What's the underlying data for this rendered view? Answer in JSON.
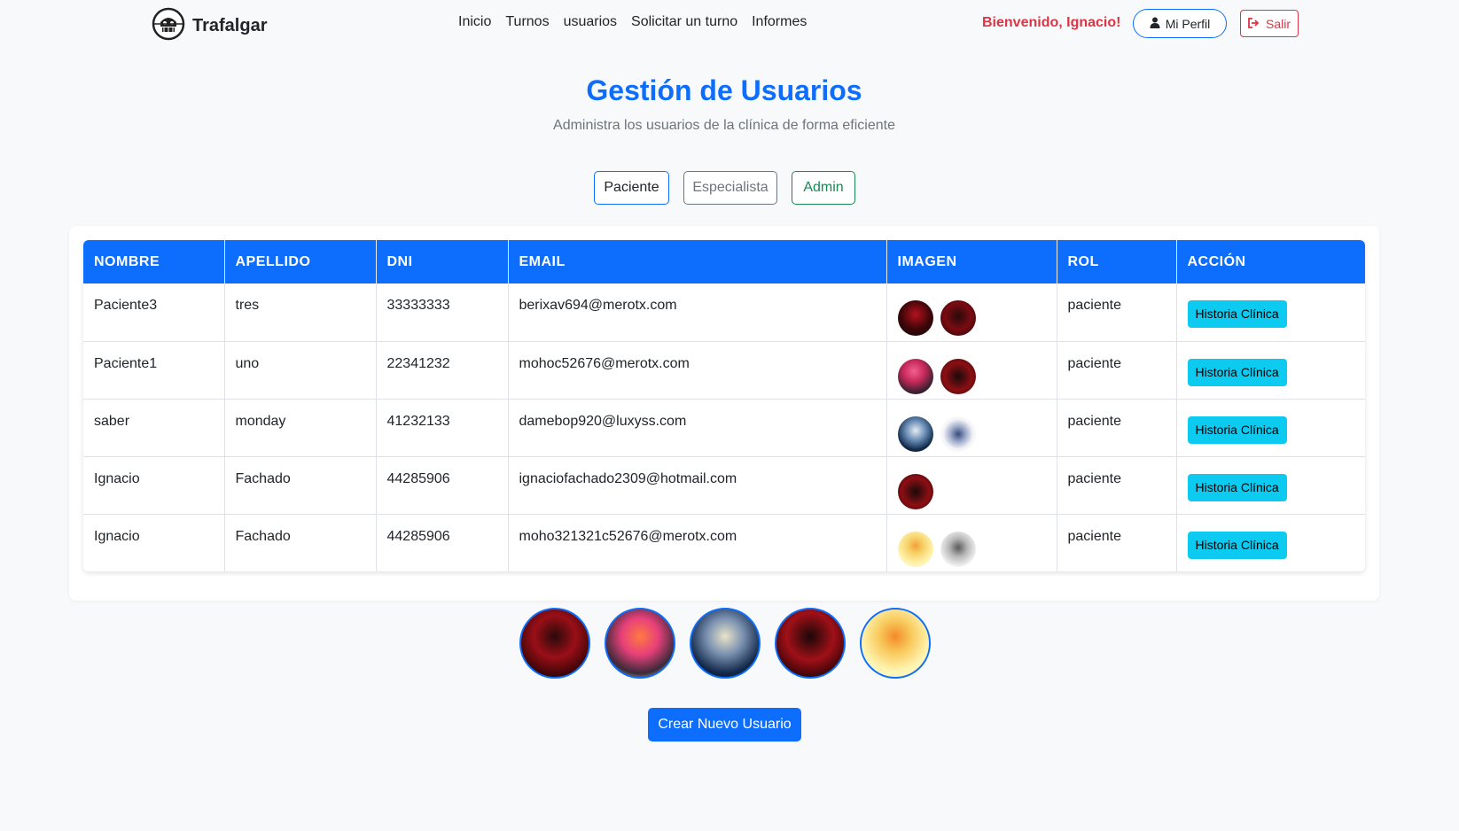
{
  "brand": {
    "name": "Trafalgar",
    "logo_icon": "jolly-roger-icon"
  },
  "nav": {
    "links": [
      "Inicio",
      "Turnos",
      "usuarios",
      "Solicitar un turno",
      "Informes"
    ]
  },
  "user": {
    "welcome": "Bienvenido, Ignacio!",
    "profile_label": "Mi Perfil",
    "logout_label": "Salir"
  },
  "header": {
    "title": "Gestión de Usuarios",
    "subtitle": "Administra los usuarios de la clínica de forma eficiente"
  },
  "filters": {
    "paciente": "Paciente",
    "especialista": "Especialista",
    "admin": "Admin"
  },
  "table": {
    "headers": [
      "NOMBRE",
      "APELLIDO",
      "DNI",
      "EMAIL",
      "IMAGEN",
      "ROL",
      "ACCIÓN"
    ],
    "rows": [
      {
        "nombre": "Paciente3",
        "apellido": "tres",
        "dni": "33333333",
        "email": "berixav694@merotx.com",
        "rol": "paciente",
        "accion": "Historia Clínica"
      },
      {
        "nombre": "Paciente1",
        "apellido": "uno",
        "dni": "22341232",
        "email": "mohoc52676@merotx.com",
        "rol": "paciente",
        "accion": "Historia Clínica"
      },
      {
        "nombre": "saber",
        "apellido": "monday",
        "dni": "41232133",
        "email": "damebop920@luxyss.com",
        "rol": "paciente",
        "accion": "Historia Clínica"
      },
      {
        "nombre": "Ignacio",
        "apellido": "Fachado",
        "dni": "44285906",
        "email": "ignaciofachado2309@hotmail.com",
        "rol": "paciente",
        "accion": "Historia Clínica"
      },
      {
        "nombre": "Ignacio",
        "apellido": "Fachado",
        "dni": "44285906",
        "email": "moho321321c52676@merotx.com",
        "rol": "paciente",
        "accion": "Historia Clínica"
      }
    ]
  },
  "create_button": "Crear Nuevo Usuario",
  "colors": {
    "primary": "#0d6efd",
    "danger": "#dc3545",
    "success": "#198754",
    "secondary": "#6c757d",
    "info": "#0dcaf0"
  }
}
